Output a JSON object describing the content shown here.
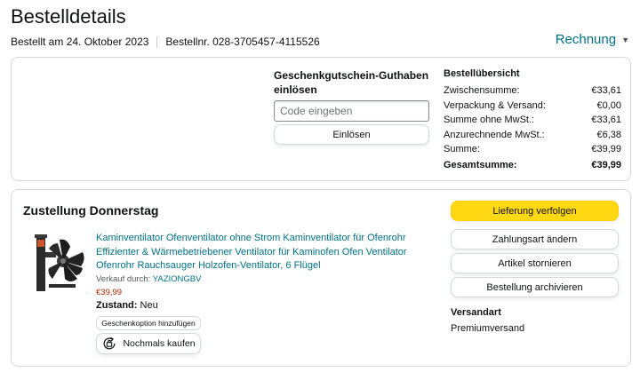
{
  "header": {
    "title": "Bestelldetails",
    "ordered_on": "Bestellt am 24. Oktober 2023",
    "order_number": "Bestellnr. 028-3705457-4115526",
    "invoice_label": "Rechnung",
    "invoice_icon": "chevron-down-icon"
  },
  "gift_card": {
    "title": "Geschenkgutschein-Guthaben einlösen",
    "placeholder": "Code eingeben",
    "redeem_label": "Einlösen"
  },
  "summary": {
    "title": "Bestellübersicht",
    "rows": [
      {
        "label": "Zwischensumme:",
        "value": "€33,61"
      },
      {
        "label": "Verpackung & Versand:",
        "value": "€0,00"
      },
      {
        "label": "Summe ohne MwSt.:",
        "value": "€33,61"
      },
      {
        "label": "Anzurechnende MwSt.:",
        "value": "€6,38"
      },
      {
        "label": "Summe:",
        "value": "€39,99"
      }
    ],
    "total_label": "Gesamtsumme:",
    "total_value": "€39,99"
  },
  "delivery": {
    "title": "Zustellung Donnerstag",
    "product": {
      "title": "Kaminventilator Ofenventilator ohne Strom Kaminventilator für Ofenrohr Effizienter & Wärmebetriebener Ventilator für Kaminofen Ofen Ventilator Ofenrohr Rauchsauger Holzofen-Ventilator, 6 Flügel",
      "seller_prefix": "Verkauf durch:",
      "seller_name": "YAZIONGBV",
      "price": "€39,99",
      "condition_label": "Zustand:",
      "condition_value": "Neu",
      "gift_option_label": "Geschenkoption hinzufügen",
      "rebuy_label": "Nochmals kaufen",
      "rebuy_icon": "buy-again-icon",
      "image_icon": "stove-fan-image"
    },
    "actions": {
      "track": "Lieferung verfolgen",
      "change_payment": "Zahlungsart ändern",
      "cancel_items": "Artikel stornieren",
      "archive_order": "Bestellung archivieren"
    },
    "shipping_title": "Versandart",
    "shipping_value": "Premiumversand"
  },
  "colors": {
    "link": "#007185",
    "price": "#b12704",
    "primary_button": "#ffd814",
    "border": "#d5d9d9"
  }
}
